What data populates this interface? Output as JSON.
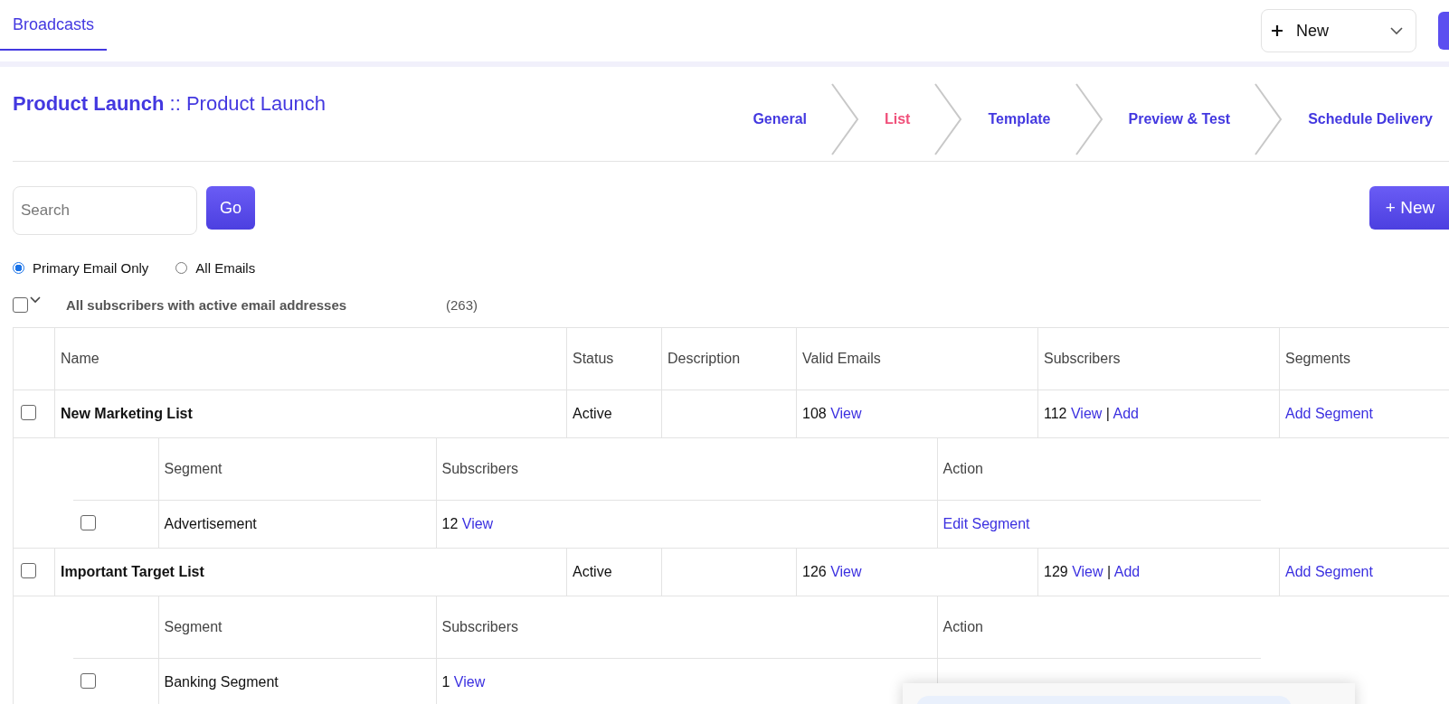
{
  "top_bar": {
    "tab": {
      "label": "Broadcasts",
      "selected": true
    },
    "new_menu": {
      "label": "New"
    }
  },
  "title": {
    "campaign": "Product Launch",
    "separator": "::",
    "name": "Product Launch"
  },
  "steps": [
    {
      "label": "General",
      "selected": false
    },
    {
      "label": "List",
      "selected": true
    },
    {
      "label": "Template",
      "selected": false
    },
    {
      "label": "Preview & Test",
      "selected": false
    },
    {
      "label": "Schedule Delivery",
      "selected": false
    }
  ],
  "search": {
    "placeholder": "Search"
  },
  "go_button": "Go",
  "new_button": "+ New",
  "email_filter": [
    {
      "label": "Primary Email Only",
      "selected": true
    },
    {
      "label": "All Emails",
      "selected": false
    }
  ],
  "select_all": {
    "checked": false,
    "label": "All subscribers with active email addresses",
    "count": "(263)"
  },
  "table": {
    "columns": [
      "Name",
      "Status",
      "Description",
      "Valid Emails",
      "Subscribers",
      "Segments"
    ],
    "rows": [
      {
        "checked": false,
        "name": "New Marketing List",
        "status": "Active",
        "valid_count": "108",
        "valid_link": "View",
        "subscribers_count": "112",
        "subscribers_view": "View",
        "separator": "|",
        "subscribers_add": "Add",
        "segments_link": "Add Segment",
        "segments": {
          "columns": [
            "Segment",
            "Subscribers",
            "Action"
          ],
          "rows": [
            {
              "checked": false,
              "name": "Advertisement",
              "count": "12",
              "link": "View",
              "action": "Edit Segment"
            }
          ]
        }
      },
      {
        "checked": false,
        "name": "Important Target List",
        "status": "Active",
        "valid_count": "126",
        "valid_link": "View",
        "subscribers_count": "129",
        "subscribers_view": "View",
        "separator": "|",
        "subscribers_add": "Add",
        "segments_link": "Add Segment",
        "segments": {
          "columns": [
            "Segment",
            "Subscribers",
            "Action"
          ],
          "rows": [
            {
              "checked": false,
              "name": "Banking Segment",
              "count": "1",
              "link": "View"
            }
          ]
        }
      }
    ]
  }
}
